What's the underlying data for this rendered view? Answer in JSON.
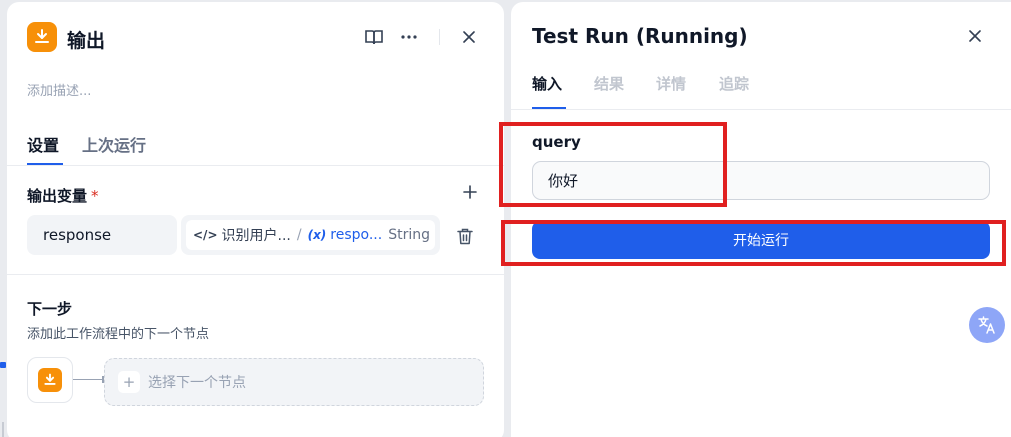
{
  "node": {
    "title": "输出",
    "description_placeholder": "添加描述...",
    "tabs": [
      {
        "label": "设置",
        "active": true
      },
      {
        "label": "上次运行",
        "active": false
      }
    ],
    "output_section": {
      "label": "输出变量",
      "required_mark": "*",
      "variables": [
        {
          "name": "response",
          "source_node": "识别用户...",
          "source_separator": "/",
          "variable_icon": "(x)",
          "variable": "respo...",
          "type": "String"
        }
      ]
    },
    "next_step": {
      "title": "下一步",
      "description": "添加此工作流程中的下一个节点",
      "select_label": "选择下一个节点",
      "plus": "+"
    }
  },
  "test_run": {
    "title": "Test Run (Running)",
    "tabs": [
      {
        "label": "输入",
        "active": true
      },
      {
        "label": "结果",
        "active": false
      },
      {
        "label": "详情",
        "active": false
      },
      {
        "label": "追踪",
        "active": false
      }
    ],
    "field": {
      "label": "query",
      "value": "你好"
    },
    "run_button": "开始运行"
  },
  "icons": {
    "node_icon": "output-node-icon",
    "header": [
      "book-icon",
      "more-icon",
      "close-icon"
    ],
    "add": "plus-icon",
    "delete": "trash-icon",
    "translate": "translate-icon"
  },
  "colors": {
    "accent": "#1f5eea",
    "node_orange": "#f79009",
    "highlight_red": "#e02020"
  }
}
